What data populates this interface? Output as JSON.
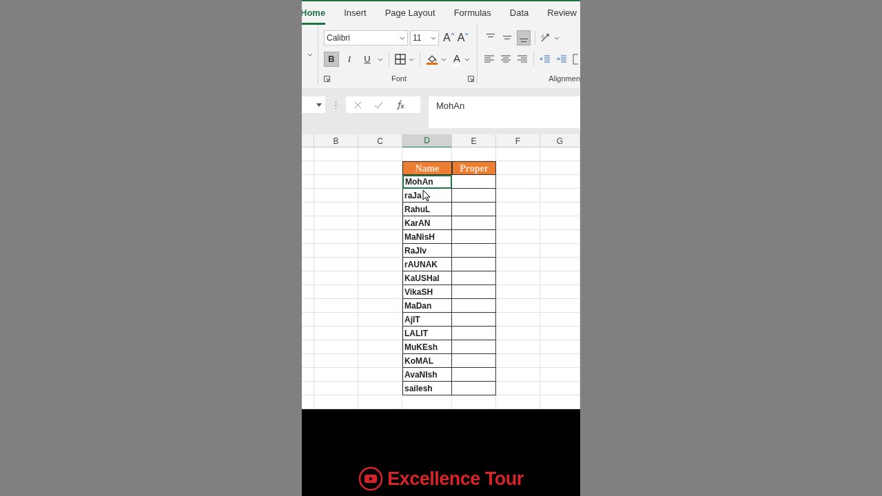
{
  "ribbon": {
    "tabs": [
      {
        "label": "Home",
        "selected": true
      },
      {
        "label": "Insert",
        "selected": false
      },
      {
        "label": "Page Layout",
        "selected": false
      },
      {
        "label": "Formulas",
        "selected": false
      },
      {
        "label": "Data",
        "selected": false
      },
      {
        "label": "Review",
        "selected": false
      }
    ],
    "font_name": "Calibri",
    "font_size": "11",
    "size_buttons": [
      {
        "kind": "grow",
        "label": "A"
      },
      {
        "kind": "shrink",
        "label": "A"
      }
    ],
    "format_buttons": [
      {
        "kind": "bold",
        "label": "B",
        "selected": true
      },
      {
        "kind": "italic",
        "label": "I",
        "selected": false
      },
      {
        "kind": "underline",
        "label": "U",
        "selected": false
      }
    ],
    "font_color_label": "A",
    "vertical_align": [
      {
        "kind": "top",
        "selected": false
      },
      {
        "kind": "middle",
        "selected": false
      },
      {
        "kind": "bottom",
        "selected": true
      }
    ],
    "groups": [
      "Font",
      "Alignmen"
    ]
  },
  "formula_bar": {
    "value": "MohAn"
  },
  "column_headers": [
    {
      "label": "B",
      "selected": false
    },
    {
      "label": "C",
      "selected": false
    },
    {
      "label": "D",
      "selected": true
    },
    {
      "label": "E",
      "selected": false
    },
    {
      "label": "F",
      "selected": false
    },
    {
      "label": "G",
      "selected": false
    }
  ],
  "table": {
    "columns": [
      "Name",
      "Proper"
    ],
    "rows": [
      {
        "name": "MohAn",
        "selected": true
      },
      {
        "name": "raJa",
        "selected": false
      },
      {
        "name": "RahuL",
        "selected": false
      },
      {
        "name": "KarAN",
        "selected": false
      },
      {
        "name": "MaNisH",
        "selected": false
      },
      {
        "name": "RaJIv",
        "selected": false
      },
      {
        "name": "rAUNAK",
        "selected": false
      },
      {
        "name": "KaUSHal",
        "selected": false
      },
      {
        "name": "VikaSH",
        "selected": false
      },
      {
        "name": "MaDan",
        "selected": false
      },
      {
        "name": "AjIT",
        "selected": false
      },
      {
        "name": "LALIT",
        "selected": false
      },
      {
        "name": "MuKEsh",
        "selected": false
      },
      {
        "name": "KoMAL",
        "selected": false
      },
      {
        "name": "AvaNIsh",
        "selected": false
      },
      {
        "name": "sailesh",
        "selected": false
      }
    ]
  },
  "channel": {
    "name": "Excellence Tour"
  }
}
